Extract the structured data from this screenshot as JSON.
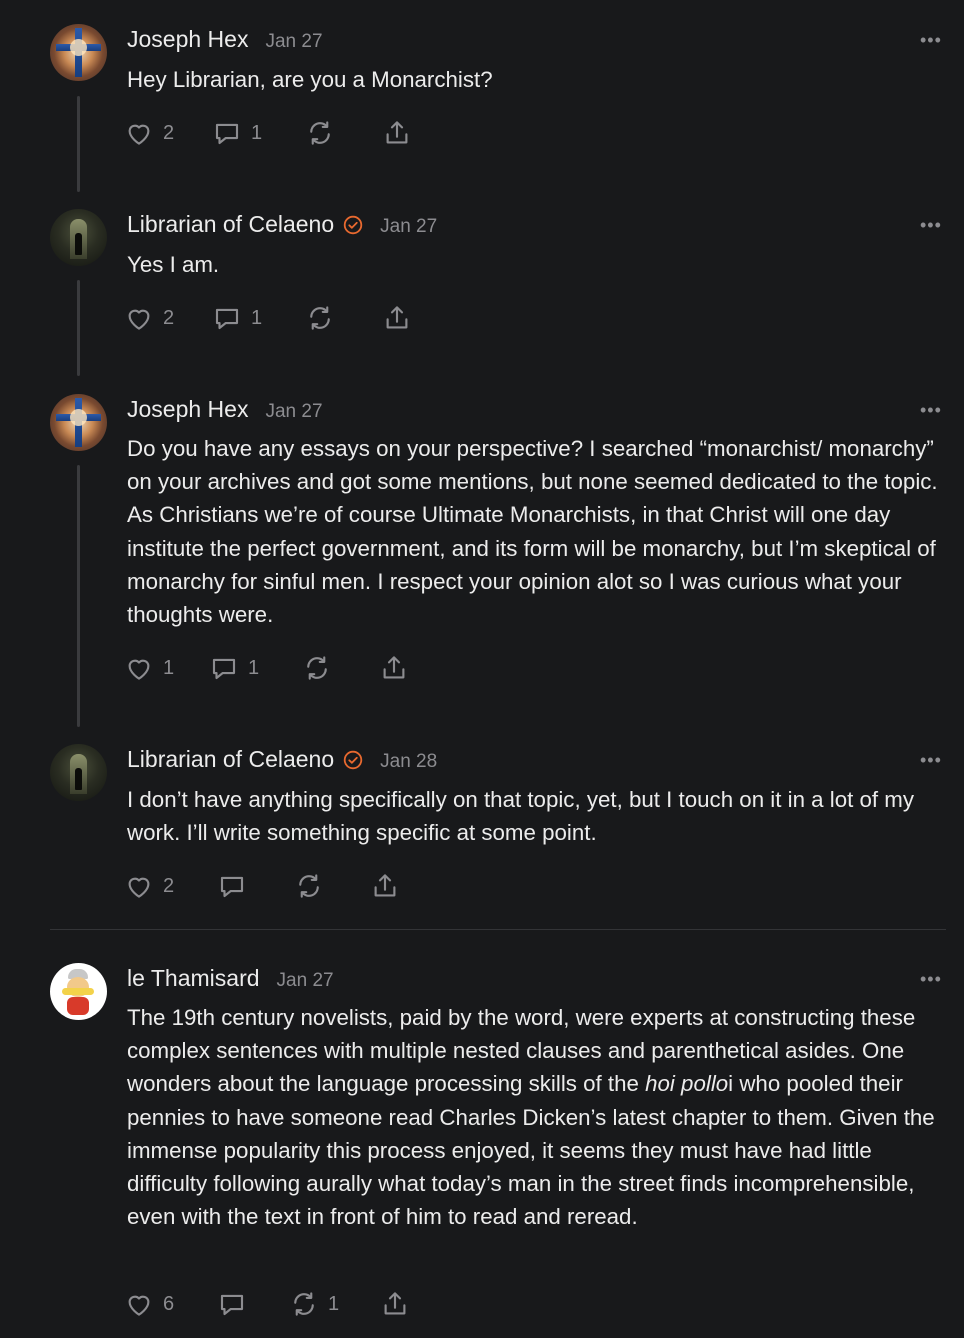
{
  "colors": {
    "background": "#18191b",
    "text": "#ececec",
    "muted": "#8c8c90",
    "verified_accent": "#e8692f",
    "thread_line": "#3a3b3e"
  },
  "comments": [
    {
      "author": "Joseph Hex",
      "date": "Jan 27",
      "verified": false,
      "text": "Hey Librarian, are you a Monarchist?",
      "likes": "2",
      "replies": "1",
      "restacks": "",
      "more_label": "•••"
    },
    {
      "author": "Librarian of Celaeno",
      "date": "Jan 27",
      "verified": true,
      "text": "Yes I am.",
      "likes": "2",
      "replies": "1",
      "restacks": "",
      "more_label": "•••"
    },
    {
      "author": "Joseph Hex",
      "date": "Jan 27",
      "verified": false,
      "text": "Do you have any essays on your perspective? I searched “monarchist/ monarchy” on your archives and got some mentions, but none seemed dedicated to the topic. As Christians we’re of course Ultimate Monarchists, in that Christ will one day institute the perfect government, and its form will be monarchy, but I’m skeptical of monarchy for sinful men. I respect your opinion alot so I was curious what your thoughts were.",
      "likes": "1",
      "replies": "1",
      "restacks": "",
      "more_label": "•••"
    },
    {
      "author": "Librarian of Celaeno",
      "date": "Jan 28",
      "verified": true,
      "text": "I don’t have anything specifically on that topic, yet, but I touch on it in a lot of my work. I’ll write something specific at some point.",
      "likes": "2",
      "replies": "",
      "restacks": "",
      "more_label": "•••"
    },
    {
      "author": "le Thamisard",
      "date": "Jan 27",
      "verified": false,
      "text_before_italic": "The 19th century novelists, paid by the word, were experts at constructing these complex sentences with multiple nested clauses and parenthetical asides. One wonders about the language processing skills of the ",
      "text_italic": "hoi pollo",
      "text_after_italic": "i who pooled their pennies to have someone read Charles Dicken’s latest chapter to them. Given the immense popularity this process enjoyed, it seems they must have had little difficulty following aurally what today’s man in the street finds incomprehensible, even with the text in front of him to read and reread.",
      "likes": "6",
      "replies": "",
      "restacks": "1",
      "more_label": "•••"
    }
  ],
  "icons": {
    "like": "heart-icon",
    "reply": "comment-bubble-icon",
    "restack": "restack-arrows-icon",
    "share": "share-upload-icon",
    "verified": "verified-check-icon",
    "more": "more-dots-icon"
  }
}
